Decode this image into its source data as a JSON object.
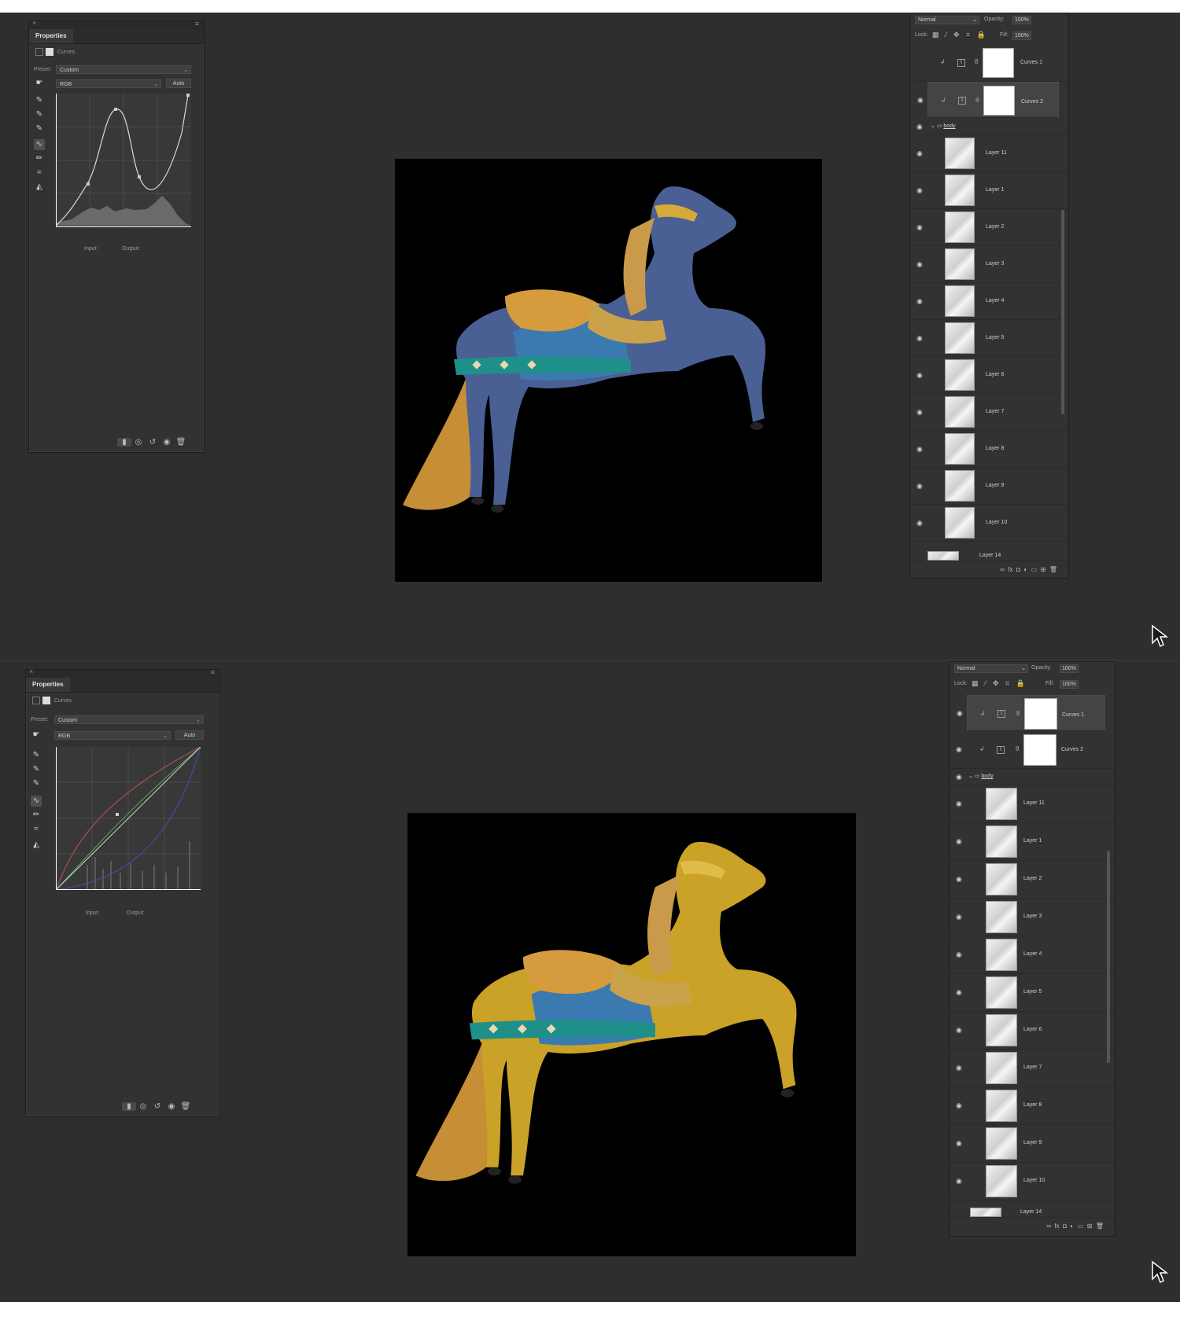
{
  "properties": {
    "title": "Properties",
    "type_label": "Curves",
    "preset_label": "Preset:",
    "preset_value": "Custom",
    "channel_value": "RGB",
    "auto_label": "Auto",
    "input_label": "Input:",
    "output_label": "Output:"
  },
  "layers_panel": {
    "blend_mode": "Normal",
    "opacity_label": "Opacity:",
    "opacity_value": "100%",
    "lock_label": "Lock:",
    "fill_label": "Fill:",
    "fill_value": "100%",
    "adjustment_layers": [
      "Curves 1",
      "Curves 2"
    ],
    "group_name": "body",
    "layers": [
      "Layer 11",
      "Layer 1",
      "Layer 2",
      "Layer 3",
      "Layer 4",
      "Layer 5",
      "Layer 6",
      "Layer 7",
      "Layer 8",
      "Layer 9",
      "Layer 10"
    ],
    "partial_layer": "Layer 14"
  },
  "screens": {
    "before": {
      "selected_layer": "Curves 2",
      "horse_body_color": "#4a5f93"
    },
    "after": {
      "selected_layer": "Curves 1",
      "horse_body_color": "#c9a227"
    }
  },
  "icons": {
    "eye": "eye-icon",
    "folder": "folder-icon",
    "mask": "mask-icon",
    "curves_adjust": "curves-adjustment-icon",
    "cursor": "mouse-cursor-icon"
  }
}
